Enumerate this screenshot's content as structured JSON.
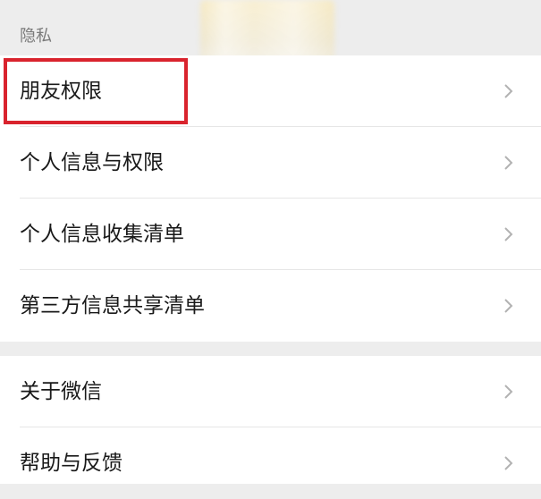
{
  "section": {
    "title": "隐私"
  },
  "privacy_items": [
    {
      "label": "朋友权限"
    },
    {
      "label": "个人信息与权限"
    },
    {
      "label": "个人信息收集清单"
    },
    {
      "label": "第三方信息共享清单"
    }
  ],
  "about_items": [
    {
      "label": "关于微信"
    },
    {
      "label": "帮助与反馈"
    }
  ],
  "icons": {
    "row_chevron": "chevron-right-icon"
  },
  "colors": {
    "highlight_box": "#d9232d",
    "background": "#ededed",
    "row_background": "#ffffff"
  }
}
